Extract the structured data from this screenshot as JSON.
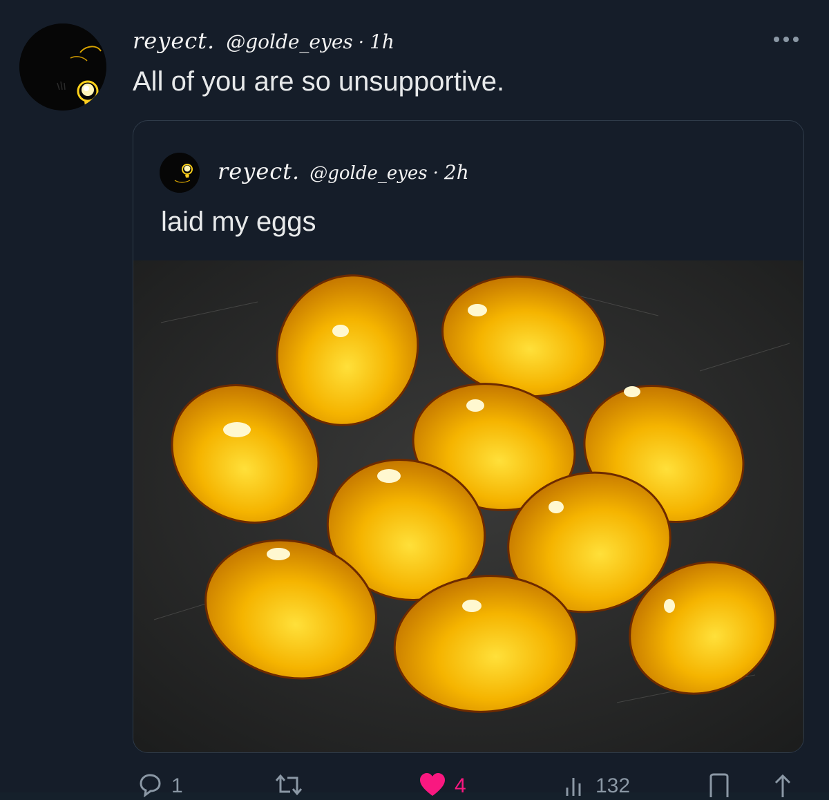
{
  "tweet": {
    "display_name": "reyect.",
    "handle": "@golde_eyes",
    "separator": "·",
    "time": "1h",
    "text": "All of you are so unsupportive.",
    "more_icon": "more-horizontal-icon"
  },
  "quoted_tweet": {
    "display_name": "reyect.",
    "handle": "@golde_eyes",
    "separator": "·",
    "time": "2h",
    "text": "laid my eggs",
    "image_subject": "yellow-eggs-photo"
  },
  "actions": {
    "reply": {
      "icon": "reply-icon",
      "count": "1"
    },
    "retweet": {
      "icon": "retweet-icon",
      "count": ""
    },
    "like": {
      "icon": "heart-icon",
      "count": "4",
      "active": true
    },
    "views": {
      "icon": "views-icon",
      "count": "132"
    },
    "bookmark": {
      "icon": "bookmark-icon"
    },
    "share": {
      "icon": "share-icon"
    }
  },
  "colors": {
    "background": "#151d29",
    "text": "#e7e9ea",
    "muted": "#8b98a5",
    "like": "#f91880",
    "egg": "#f0a800",
    "border": "#2f3b49"
  }
}
